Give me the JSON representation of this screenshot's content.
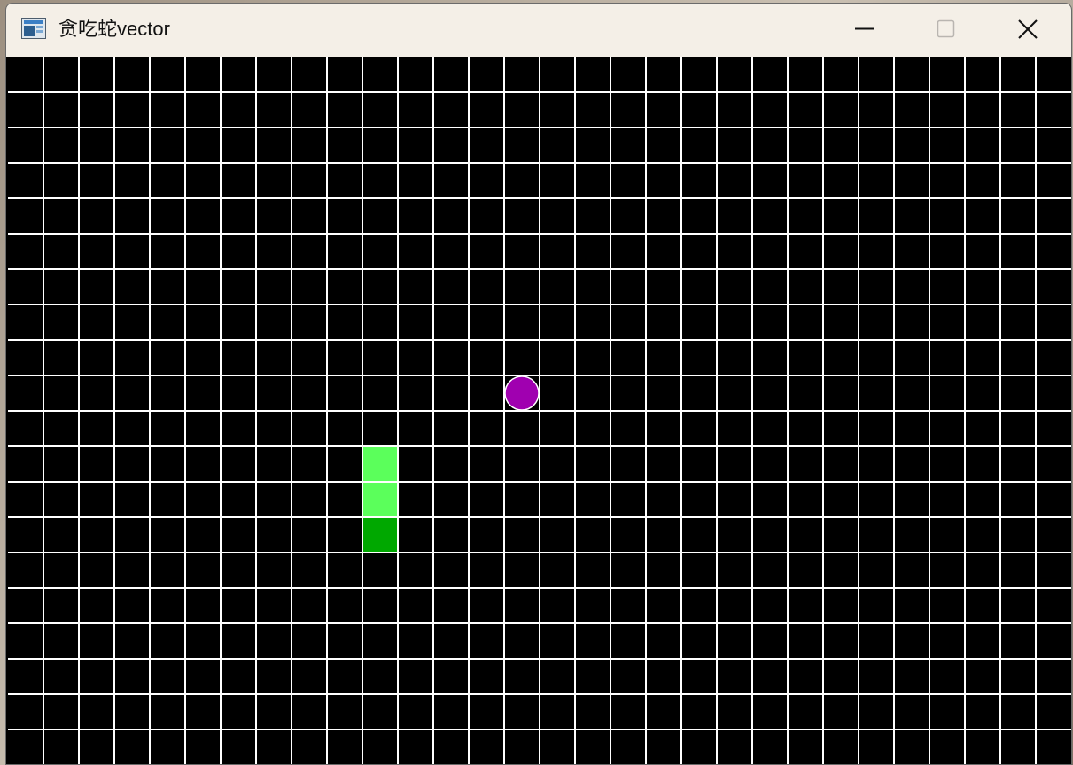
{
  "window": {
    "title": "贪吃蛇vector",
    "controls": {
      "minimize_icon": "minimize-icon",
      "maximize_icon": "maximize-icon",
      "close_icon": "close-icon"
    }
  },
  "game": {
    "grid_columns": 30,
    "grid_rows": 20,
    "background_color": "#000000",
    "grid_line_color": "#ffffff",
    "snake": {
      "head_color": "#00a800",
      "body_color": "#5bff5b",
      "segments": [
        {
          "col": 10,
          "row": 13,
          "part": "head"
        },
        {
          "col": 10,
          "row": 12,
          "part": "body"
        },
        {
          "col": 10,
          "row": 11,
          "part": "body"
        }
      ]
    },
    "food": {
      "col": 14,
      "row": 9,
      "color": "#a000b0",
      "outline_color": "#ffffff"
    }
  }
}
